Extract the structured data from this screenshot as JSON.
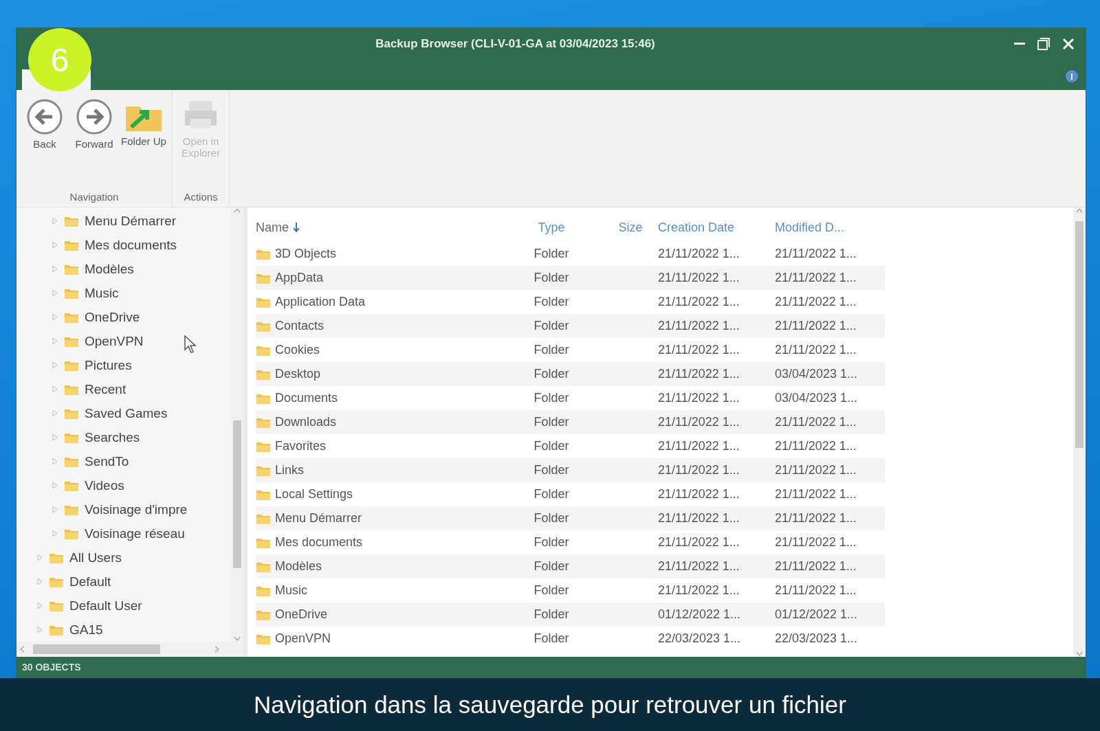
{
  "window": {
    "title": "Backup Browser (CLI-V-01-GA at 03/04/2023 15:46)"
  },
  "step_badge": "6",
  "ribbon": {
    "groups": [
      {
        "label": "Navigation",
        "buttons": [
          {
            "kind": "back",
            "label": "Back",
            "disabled": false
          },
          {
            "kind": "forward",
            "label": "Forward",
            "disabled": false
          },
          {
            "kind": "folder_up",
            "label": "Folder Up",
            "disabled": false
          }
        ]
      },
      {
        "label": "Actions",
        "buttons": [
          {
            "kind": "explorer",
            "label": "Open in Explorer",
            "disabled": true
          }
        ]
      }
    ]
  },
  "tree": [
    {
      "children": [
        {
          "label": "Menu Démarrer"
        },
        {
          "label": "Mes documents"
        },
        {
          "label": "Modèles"
        },
        {
          "label": "Music"
        },
        {
          "label": "OneDrive"
        },
        {
          "label": "OpenVPN"
        },
        {
          "label": "Pictures"
        },
        {
          "label": "Recent"
        },
        {
          "label": "Saved Games"
        },
        {
          "label": "Searches"
        },
        {
          "label": "SendTo"
        },
        {
          "label": "Videos"
        },
        {
          "label": "Voisinage d'impre"
        },
        {
          "label": "Voisinage réseau"
        }
      ]
    },
    {
      "label": "All Users"
    },
    {
      "label": "Default"
    },
    {
      "label": "Default User"
    },
    {
      "label": "GA15"
    }
  ],
  "table": {
    "columns": [
      "Name",
      "Type",
      "Size",
      "Creation Date",
      "Modified D..."
    ],
    "rows": [
      [
        "3D Objects",
        "Folder",
        "",
        "21/11/2022 1...",
        "21/11/2022 1..."
      ],
      [
        "AppData",
        "Folder",
        "",
        "21/11/2022 1...",
        "21/11/2022 1..."
      ],
      [
        "Application Data",
        "Folder",
        "",
        "21/11/2022 1...",
        "21/11/2022 1..."
      ],
      [
        "Contacts",
        "Folder",
        "",
        "21/11/2022 1...",
        "21/11/2022 1..."
      ],
      [
        "Cookies",
        "Folder",
        "",
        "21/11/2022 1...",
        "21/11/2022 1..."
      ],
      [
        "Desktop",
        "Folder",
        "",
        "21/11/2022 1...",
        "03/04/2023 1..."
      ],
      [
        "Documents",
        "Folder",
        "",
        "21/11/2022 1...",
        "03/04/2023 1..."
      ],
      [
        "Downloads",
        "Folder",
        "",
        "21/11/2022 1...",
        "21/11/2022 1..."
      ],
      [
        "Favorites",
        "Folder",
        "",
        "21/11/2022 1...",
        "21/11/2022 1..."
      ],
      [
        "Links",
        "Folder",
        "",
        "21/11/2022 1...",
        "21/11/2022 1..."
      ],
      [
        "Local Settings",
        "Folder",
        "",
        "21/11/2022 1...",
        "21/11/2022 1..."
      ],
      [
        "Menu Démarrer",
        "Folder",
        "",
        "21/11/2022 1...",
        "21/11/2022 1..."
      ],
      [
        "Mes documents",
        "Folder",
        "",
        "21/11/2022 1...",
        "21/11/2022 1..."
      ],
      [
        "Modèles",
        "Folder",
        "",
        "21/11/2022 1...",
        "21/11/2022 1..."
      ],
      [
        "Music",
        "Folder",
        "",
        "21/11/2022 1...",
        "21/11/2022 1..."
      ],
      [
        "OneDrive",
        "Folder",
        "",
        "01/12/2022 1...",
        "01/12/2022 1..."
      ],
      [
        "OpenVPN",
        "Folder",
        "",
        "22/03/2023 1...",
        "22/03/2023 1..."
      ]
    ]
  },
  "status_bar": "30 OBJECTS",
  "caption": "Navigation dans la sauvegarde pour retrouver un fichier"
}
